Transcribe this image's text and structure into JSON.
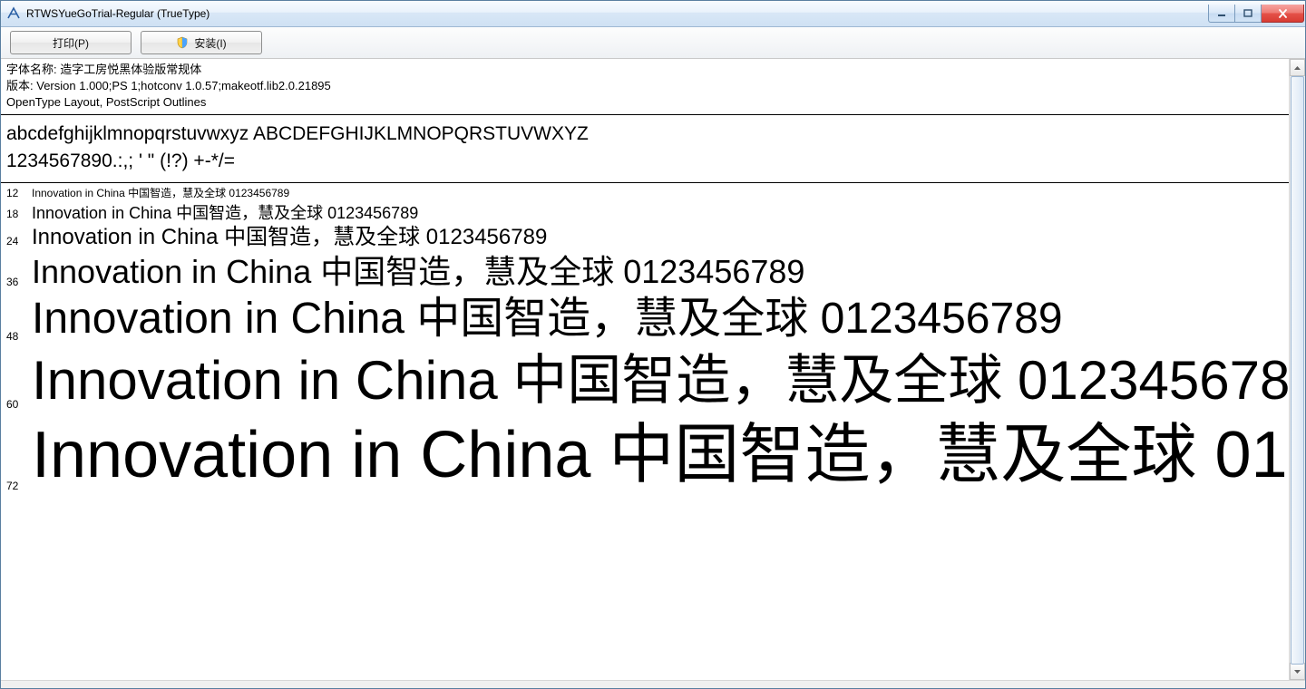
{
  "titlebar": {
    "title": "RTWSYueGoTrial-Regular (TrueType)"
  },
  "toolbar": {
    "print_label": "打印(P)",
    "install_label": "安装(I)"
  },
  "info": {
    "name_label": "字体名称:",
    "name_value": "造字工房悦黑体验版常规体",
    "version_label": "版本:",
    "version_value": "Version 1.000;PS 1;hotconv 1.0.57;makeotf.lib2.0.21895",
    "layout_line": "OpenType Layout, PostScript Outlines"
  },
  "glyphs": {
    "line1": "abcdefghijklmnopqrstuvwxyz ABCDEFGHIJKLMNOPQRSTUVWXYZ",
    "line2": "1234567890.:,; ' \" (!?) +-*/="
  },
  "sample_text": "Innovation in China 中国智造，慧及全球 0123456789",
  "sample_sizes": [
    12,
    18,
    24,
    36,
    48,
    60,
    72
  ]
}
